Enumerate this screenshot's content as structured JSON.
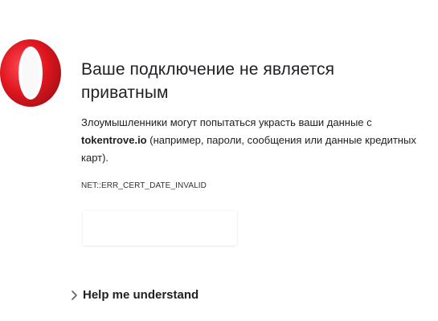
{
  "logo": {
    "icon": "opera-logo",
    "brand_color": "#e0161f"
  },
  "title": "Ваше подключение не является приватным",
  "description": {
    "before": "Злоумышленники могут попытаться украсть ваши данные с ",
    "domain": "tokentrove.io",
    "after": " (например, пароли, сообщения или данные кредитных карт)."
  },
  "error_code": "NET::ERR_CERT_DATE_INVALID",
  "help": {
    "label": "Help me understand",
    "icon": "chevron-right-icon"
  }
}
